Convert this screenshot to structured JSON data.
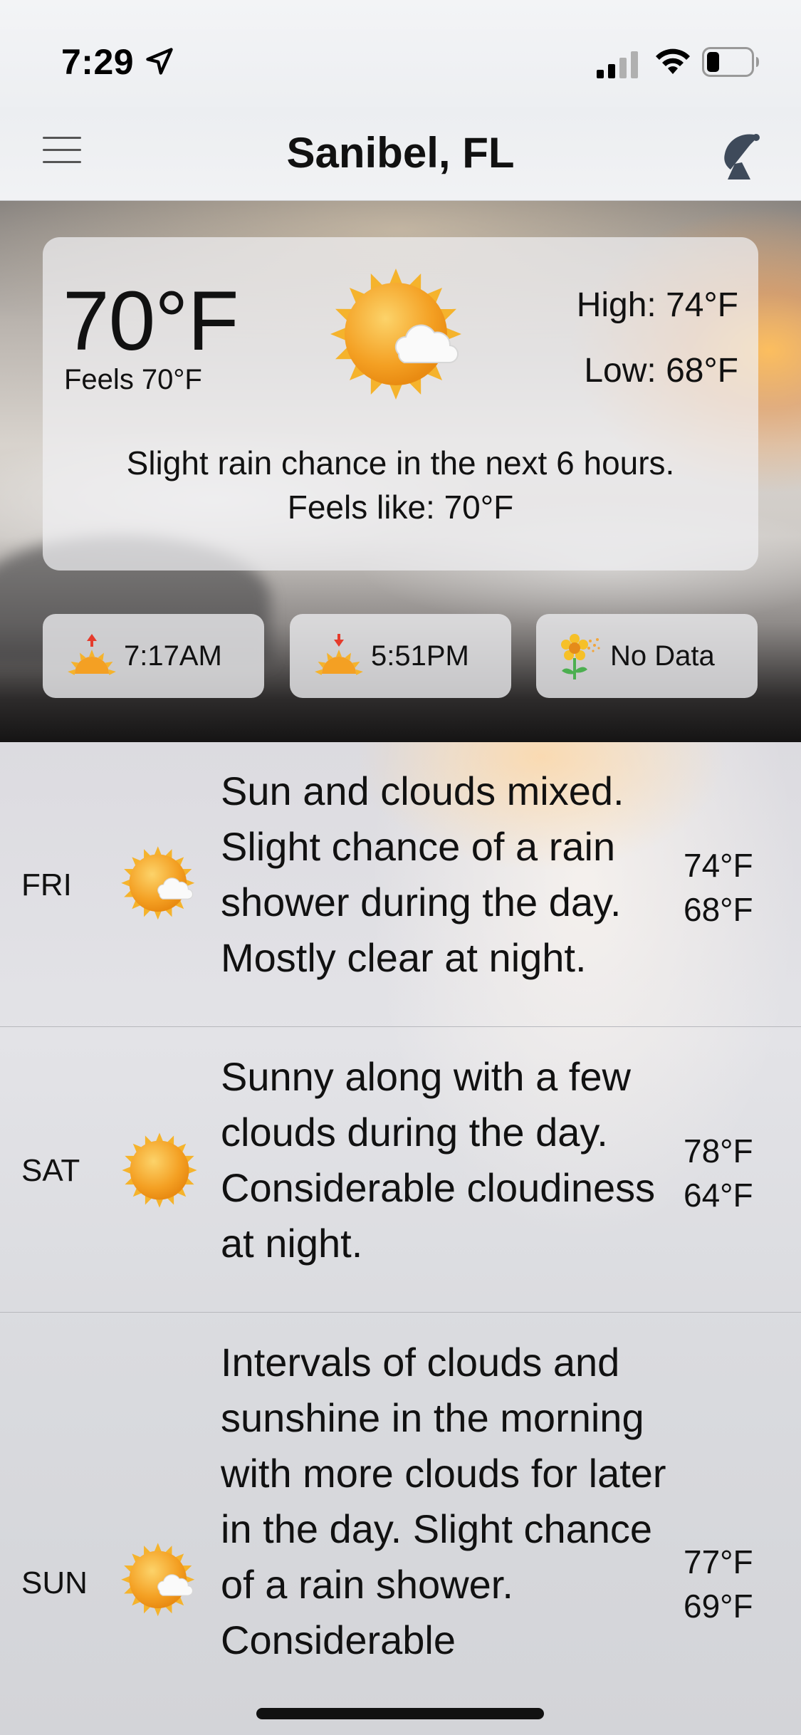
{
  "status_bar": {
    "time": "7:29",
    "location_icon": "location-arrow-icon",
    "signal_icon": "cellular-signal-icon",
    "wifi_icon": "wifi-icon",
    "battery_icon": "battery-icon",
    "battery_level": 0.25
  },
  "nav": {
    "menu_icon": "hamburger-menu-icon",
    "title": "Sanibel, FL",
    "radar_icon": "satellite-dish-icon"
  },
  "current": {
    "temperature": "70°F",
    "feels_short": "Feels 70°F",
    "condition_icon": "sun-cloud-icon",
    "high": "High: 74°F",
    "low": "Low: 68°F",
    "summary_line1": "Slight rain chance in the next 6 hours.",
    "summary_line2": "Feels like: 70°F"
  },
  "pills": {
    "sunrise": {
      "icon": "sunrise-icon",
      "value": "7:17AM"
    },
    "sunset": {
      "icon": "sunset-icon",
      "value": "5:51PM"
    },
    "pollen": {
      "icon": "pollen-flower-icon",
      "value": "No Data"
    }
  },
  "forecast": [
    {
      "day": "FRI",
      "icon": "sun-cloud-icon",
      "description": "Sun and clouds mixed. Slight chance of a rain shower during the day. Mostly clear at night.",
      "high": "74°F",
      "low": "68°F"
    },
    {
      "day": "SAT",
      "icon": "sun-icon",
      "description": "Sunny along with a few clouds during the day. Considerable cloudiness at night.",
      "high": "78°F",
      "low": "64°F"
    },
    {
      "day": "SUN",
      "icon": "sun-cloud-icon",
      "description": "Intervals of clouds and sunshine in the morning with more clouds for later in the day. Slight chance of a rain shower. Considerable",
      "high": "77°F",
      "low": "69°F"
    }
  ],
  "colors": {
    "sun_core": "#f6a623",
    "sun_ray": "#f5b32c",
    "sunrise_arrow": "#e53b2c",
    "text": "#111111"
  }
}
